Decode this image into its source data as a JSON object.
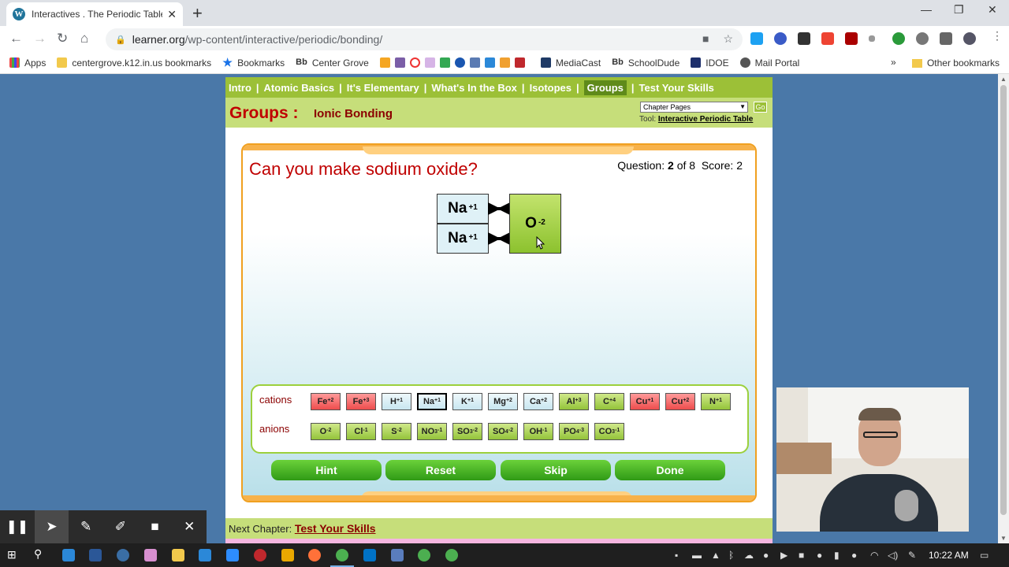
{
  "browser": {
    "tab_title": "Interactives . The Periodic Table .",
    "tab_close": "✕",
    "new_tab": "+",
    "url_host": "learner.org",
    "url_path": "/wp-content/interactive/periodic/bonding/",
    "window_controls": [
      "—",
      "❐",
      "✕"
    ]
  },
  "bookmarks": {
    "items": [
      "Apps",
      "centergrove.k12.in.us bookmarks",
      "Bookmarks",
      "Center Grove",
      "MediaCast",
      "SchoolDude",
      "IDOE",
      "Mail Portal"
    ],
    "more": "»",
    "other": "Other bookmarks"
  },
  "nav": {
    "items": [
      "Intro",
      "Atomic Basics",
      "It's Elementary",
      "What's In the Box",
      "Isotopes",
      "Groups",
      "Test Your Skills"
    ],
    "active": "Groups"
  },
  "header": {
    "title": "Groups :",
    "subtitle": "Ionic Bonding",
    "select_value": "Chapter Pages",
    "go_label": "Go",
    "tool_label": "Tool:",
    "tool_link": "Interactive Periodic Table"
  },
  "game": {
    "question": "Can you make sodium oxide?",
    "score_prefix": "Question:",
    "question_num": "2",
    "question_of": "of 8",
    "score_label": "Score:",
    "score_value": "2",
    "workspace": {
      "cations": [
        {
          "symbol": "Na",
          "charge": "+1"
        },
        {
          "symbol": "Na",
          "charge": "+1"
        }
      ],
      "anion": {
        "symbol": "O",
        "charge": "-2"
      }
    },
    "bank": {
      "cations_label": "cations",
      "anions_label": "anions",
      "cations": [
        {
          "base": "Fe",
          "charge": "+2",
          "color": "red"
        },
        {
          "base": "Fe",
          "charge": "+3",
          "color": "red"
        },
        {
          "base": "H",
          "charge": "+1",
          "color": "blue"
        },
        {
          "base": "Na",
          "charge": "+1",
          "color": "blue",
          "selected": true
        },
        {
          "base": "K",
          "charge": "+1",
          "color": "blue"
        },
        {
          "base": "Mg",
          "charge": "+2",
          "color": "blue"
        },
        {
          "base": "Ca",
          "charge": "+2",
          "color": "blue"
        },
        {
          "base": "Al",
          "charge": "+3",
          "color": "green"
        },
        {
          "base": "C",
          "charge": "+4",
          "color": "green"
        },
        {
          "base": "Cu",
          "charge": "+1",
          "color": "red"
        },
        {
          "base": "Cu",
          "charge": "+2",
          "color": "red"
        },
        {
          "base": "N",
          "charge": "+1",
          "color": "green"
        }
      ],
      "anions": [
        {
          "base": "O",
          "charge": "-2",
          "color": "green"
        },
        {
          "base": "Cl",
          "charge": "-1",
          "color": "green"
        },
        {
          "base": "S",
          "charge": "-2",
          "color": "green"
        },
        {
          "base": "NO",
          "sub": "3",
          "charge": "-1",
          "color": "green"
        },
        {
          "base": "SO",
          "sub": "3",
          "charge": "-2",
          "color": "green"
        },
        {
          "base": "SO",
          "sub": "4",
          "charge": "-2",
          "color": "green"
        },
        {
          "base": "OH",
          "charge": "-1",
          "color": "green"
        },
        {
          "base": "PO",
          "sub": "4",
          "charge": "-3",
          "color": "green"
        },
        {
          "base": "CO",
          "sub": "3",
          "charge": "-1",
          "color": "green"
        }
      ]
    },
    "buttons": [
      "Hint",
      "Reset",
      "Skip",
      "Done"
    ]
  },
  "footer": {
    "next_label": "Next Chapter:",
    "next_link": "Test Your Skills"
  },
  "recorder": {
    "tools": [
      "pause-icon",
      "pointer-icon",
      "pen-icon",
      "highlighter-icon",
      "camera-icon",
      "close-icon"
    ]
  },
  "taskbar": {
    "clock": "10:22 AM"
  },
  "colors": {
    "nav_green": "#9cc037",
    "header_green": "#c6de7a",
    "title_red": "#c00000",
    "button_green": "#2f9a16",
    "desktop_blue": "#4a78a8"
  }
}
